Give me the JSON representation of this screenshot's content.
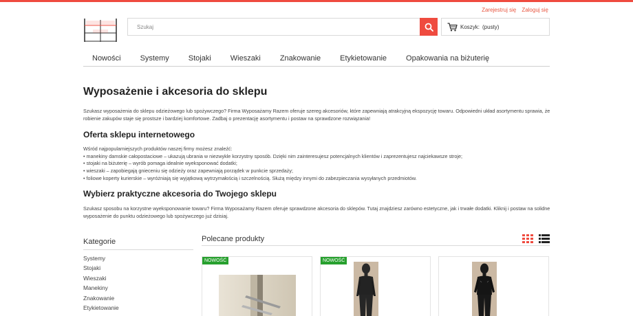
{
  "header": {
    "auth": {
      "register": "Zarejestruj się",
      "login": "Zaloguj się"
    },
    "logo": {
      "line1": "WYPOSAŻAMY",
      "line2": "RAZEM"
    },
    "search": {
      "placeholder": "Szukaj"
    },
    "cart": {
      "label": "Koszyk:",
      "status": "(pusty)"
    },
    "accent_color": "#ef4b3f"
  },
  "nav": {
    "items": [
      "Nowości",
      "Systemy",
      "Stojaki",
      "Wieszaki",
      "Znakowanie",
      "Etykietowanie",
      "Opakowania na biżuterię"
    ]
  },
  "main": {
    "title": "Wyposażenie i akcesoria do sklepu",
    "intro": "Szukasz wyposażenia do sklepu odzieżowego lub spożywczego? Firma Wyposażamy Razem oferuje szereg akcesoriów, które zapewniają atrakcyjną ekspozycję towaru. Odpowiedni układ asortymentu sprawia, że robienie zakupów staje się prostsze i bardziej komfortowe. Zadbaj o prezentację asortymentu i postaw na sprawdzone rozwiązania!",
    "offer_heading": "Oferta sklepu internetowego",
    "offer_lead": "Wśród najpopularniejszych produktów naszej firmy możesz znaleźć:",
    "offer_items": [
      "• manekiny damskie całopostaciowe – ukazują ubrania w niezwykle korzystny sposób. Dzięki nim zainteresujesz potencjalnych klientów i zaprezentujesz najciekawsze stroje;",
      "• stojaki na biżuterię – wyrób pomaga idealnie wyeksponować dodatki;",
      "• wieszaki – zapobiegają gnieceniu się odzieży oraz zapewniają porządek w punkcie sprzedaży;",
      "• foliowe koperty kurierskie – wyróżniają się wyjątkową wytrzymałością i szczelnością. Służą między innymi do zabezpieczania wysyłanych przedmiotów."
    ],
    "practical_heading": "Wybierz praktyczne akcesoria do Twojego sklepu",
    "practical_text": "Szukasz sposobu na korzystne wyeksponowanie towaru? Firma Wyposażamy Razem oferuje sprawdzone akcesoria do sklepów. Tutaj znajdziesz zarówno estetyczne, jak i trwałe dodatki. Kliknij i postaw na solidne wyposażenie do punktu odzieżowego lub spożywczego już dzisiaj."
  },
  "sidebar": {
    "title": "Kategorie",
    "items": [
      "Systemy",
      "Stojaki",
      "Wieszaki",
      "Manekiny",
      "Znakowanie",
      "Etykietowanie"
    ]
  },
  "products": {
    "title": "Polecane produkty",
    "cards": [
      {
        "badge": "NOWOŚĆ",
        "icon": "slatwall-hook-image"
      },
      {
        "badge": "NOWOŚĆ",
        "icon": "black-mannequin-image"
      },
      {
        "badge": "",
        "icon": "black-mannequin-image"
      }
    ]
  }
}
